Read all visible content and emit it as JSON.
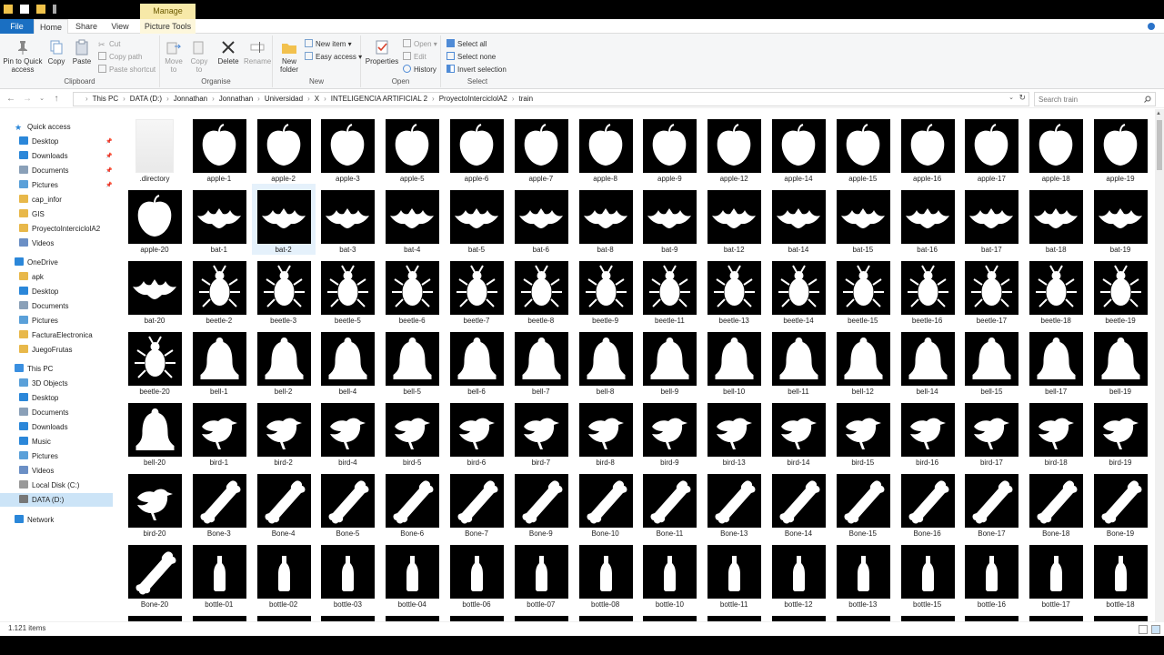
{
  "titlebar": {
    "manage": "Manage"
  },
  "tabs": {
    "file": "File",
    "home": "Home",
    "share": "Share",
    "view": "View",
    "picture_tools": "Picture Tools"
  },
  "ribbon": {
    "clipboard": {
      "label": "Clipboard",
      "pin": "Pin to Quick access",
      "copy": "Copy",
      "paste": "Paste",
      "cut": "Cut",
      "copy_path": "Copy path",
      "paste_shortcut": "Paste shortcut"
    },
    "organise": {
      "label": "Organise",
      "move_to": "Move to",
      "copy_to": "Copy to",
      "delete": "Delete",
      "rename": "Rename"
    },
    "new": {
      "label": "New",
      "new_folder": "New folder",
      "new_item": "New item",
      "easy_access": "Easy access"
    },
    "open": {
      "label": "Open",
      "properties": "Properties",
      "open": "Open",
      "edit": "Edit",
      "history": "History"
    },
    "select": {
      "label": "Select",
      "select_all": "Select all",
      "select_none": "Select none",
      "invert": "Invert selection"
    }
  },
  "address": {
    "crumbs": [
      "This PC",
      "DATA (D:)",
      "Jonnathan",
      "Jonnathan",
      "Universidad",
      "X",
      "INTELIGENCIA ARTIFICIAL 2",
      "ProyectoInterciclolA2",
      "train"
    ],
    "search_placeholder": "Search train"
  },
  "nav": {
    "quick_access": "Quick access",
    "quick": [
      "Desktop",
      "Downloads",
      "Documents",
      "Pictures",
      "cap_infor",
      "GIS",
      "ProyectoInterciclolA2",
      "Videos"
    ],
    "onedrive": "OneDrive",
    "onedrive_items": [
      "apk",
      "Desktop",
      "Documents",
      "Pictures",
      "FacturaElectronica",
      "JuegoFrutas"
    ],
    "this_pc": "This PC",
    "pc_items": [
      "3D Objects",
      "Desktop",
      "Documents",
      "Downloads",
      "Music",
      "Pictures",
      "Videos",
      "Local Disk (C:)",
      "DATA (D:)"
    ],
    "network": "Network"
  },
  "files": [
    [
      ".directory",
      "apple-1",
      "apple-2",
      "apple-3",
      "apple-5",
      "apple-6",
      "apple-7",
      "apple-8",
      "apple-9",
      "apple-12",
      "apple-14",
      "apple-15",
      "apple-16",
      "apple-17",
      "apple-18",
      "apple-19"
    ],
    [
      "apple-20",
      "bat-1",
      "bat-2",
      "bat-3",
      "bat-4",
      "bat-5",
      "bat-6",
      "bat-8",
      "bat-9",
      "bat-12",
      "bat-14",
      "bat-15",
      "bat-16",
      "bat-17",
      "bat-18",
      "bat-19"
    ],
    [
      "bat-20",
      "beetle-2",
      "beetle-3",
      "beetle-5",
      "beetle-6",
      "beetle-7",
      "beetle-8",
      "beetle-9",
      "beetle-11",
      "beetle-13",
      "beetle-14",
      "beetle-15",
      "beetle-16",
      "beetle-17",
      "beetle-18",
      "beetle-19"
    ],
    [
      "beetle-20",
      "bell-1",
      "bell-2",
      "bell-4",
      "bell-5",
      "bell-6",
      "bell-7",
      "bell-8",
      "bell-9",
      "bell-10",
      "bell-11",
      "bell-12",
      "bell-14",
      "bell-15",
      "bell-17",
      "bell-19"
    ],
    [
      "bell-20",
      "bird-1",
      "bird-2",
      "bird-4",
      "bird-5",
      "bird-6",
      "bird-7",
      "bird-8",
      "bird-9",
      "bird-13",
      "bird-14",
      "bird-15",
      "bird-16",
      "bird-17",
      "bird-18",
      "bird-19"
    ],
    [
      "bird-20",
      "Bone-3",
      "Bone-4",
      "Bone-5",
      "Bone-6",
      "Bone-7",
      "Bone-9",
      "Bone-10",
      "Bone-11",
      "Bone-13",
      "Bone-14",
      "Bone-15",
      "Bone-16",
      "Bone-17",
      "Bone-18",
      "Bone-19"
    ],
    [
      "Bone-20",
      "bottle-01",
      "bottle-02",
      "bottle-03",
      "bottle-04",
      "bottle-06",
      "bottle-07",
      "bottle-08",
      "bottle-10",
      "bottle-11",
      "bottle-12",
      "bottle-13",
      "bottle-15",
      "bottle-16",
      "bottle-17",
      "bottle-18"
    ]
  ],
  "selected_file": "bat-2",
  "status": {
    "count": "1.121 items"
  },
  "colors": {
    "accent": "#1a6fc2",
    "manage_tab": "#f7e9a8",
    "selection": "#cce4f7"
  }
}
